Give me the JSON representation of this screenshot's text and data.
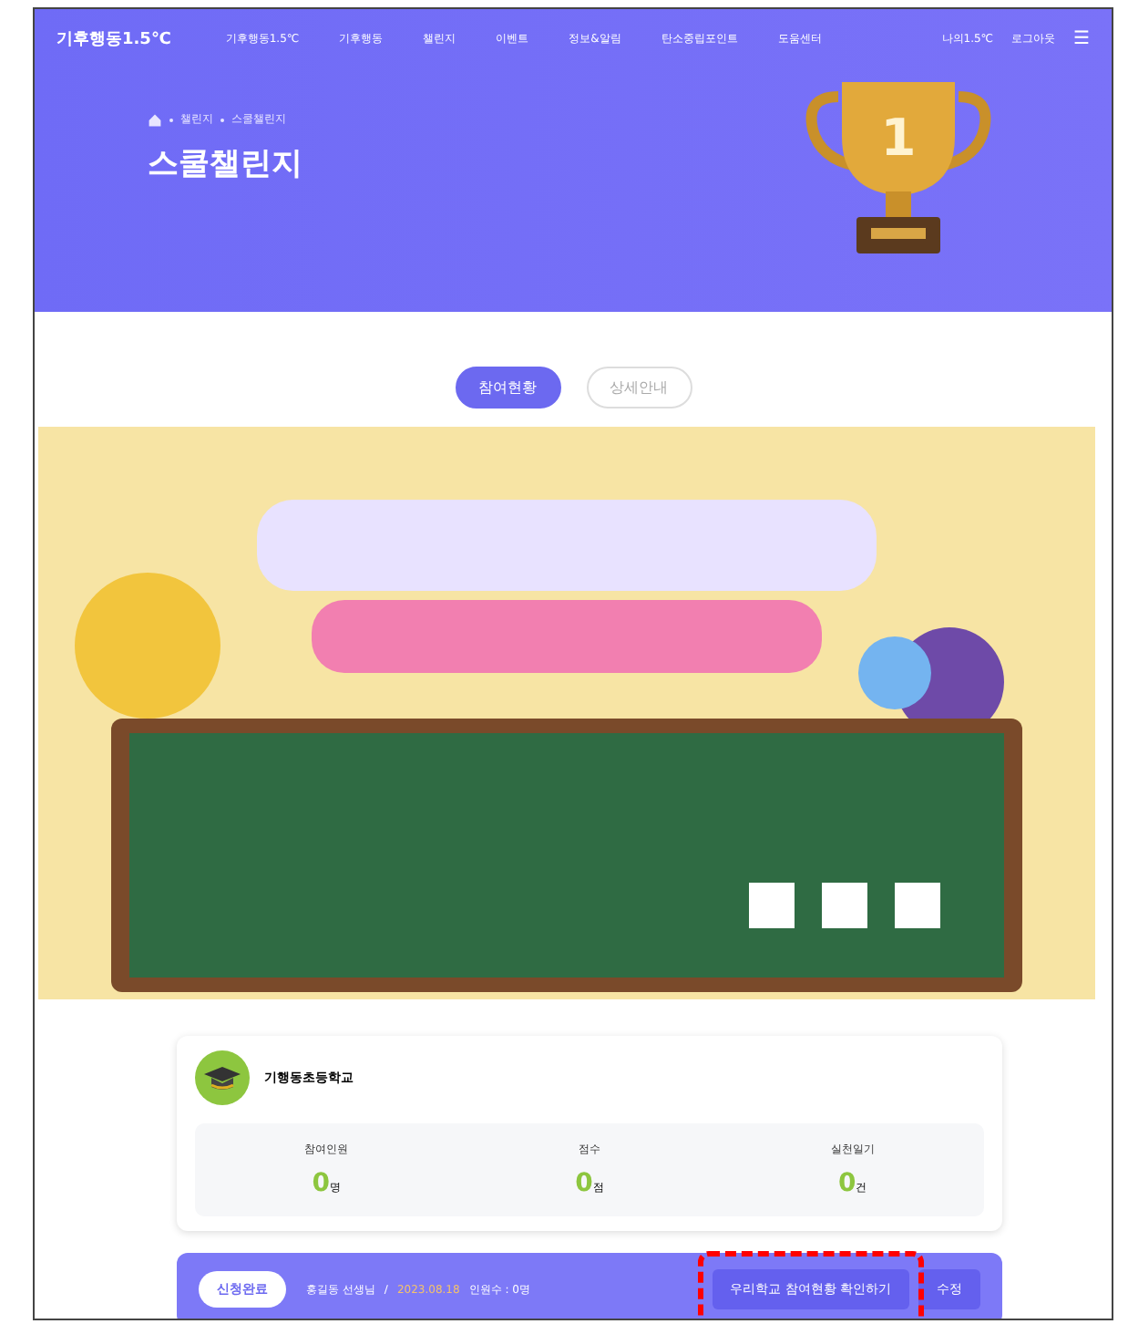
{
  "header": {
    "logo": "기후행동1.5℃",
    "nav": [
      "기후행동1.5℃",
      "기후행동",
      "챌린지",
      "이벤트",
      "정보&알림",
      "탄소중립포인트",
      "도움센터"
    ],
    "user_links": [
      "나의1.5℃",
      "로그아웃"
    ],
    "menu_icon": "☰"
  },
  "hero": {
    "breadcrumb": [
      "챌린지",
      "스쿨챌린지"
    ],
    "title": "스쿨챌린지",
    "trophy_number": "1"
  },
  "tabs": [
    {
      "label": "참여현황",
      "selected": true
    },
    {
      "label": "상세안내",
      "selected": false
    }
  ],
  "school": {
    "name": "기행동초등학교",
    "stats": [
      {
        "label": "참여인원",
        "value": "0",
        "unit": "명"
      },
      {
        "label": "점수",
        "value": "0",
        "unit": "점"
      },
      {
        "label": "실천일기",
        "value": "0",
        "unit": "건"
      }
    ]
  },
  "application": {
    "status": "신청완료",
    "teacher": "홍길동 선생님",
    "separator": "/",
    "date": "2023.08.18",
    "count": "인원수 : 0명",
    "buttons": [
      "우리학교 참여현황 확인하기",
      "수정"
    ],
    "highlighted": true
  }
}
